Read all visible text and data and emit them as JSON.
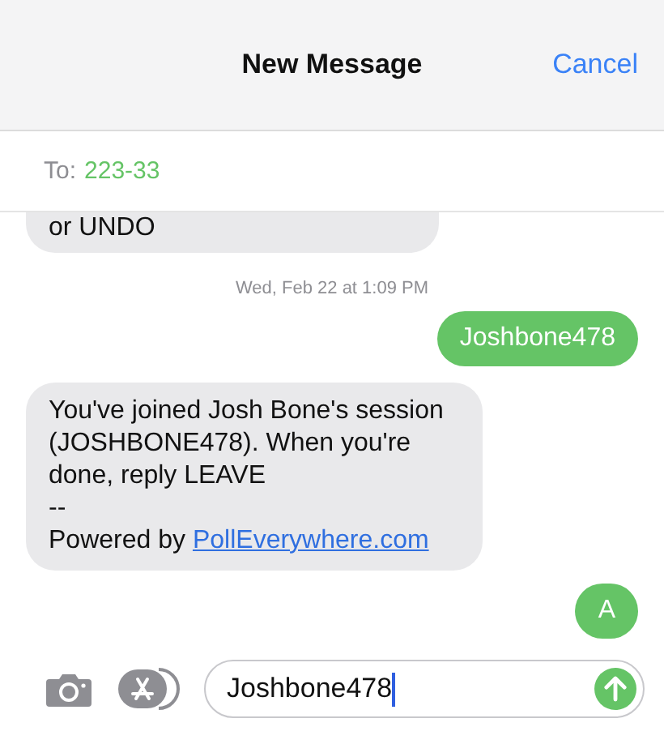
{
  "header": {
    "title": "New Message",
    "cancel": "Cancel"
  },
  "to": {
    "label": "To:",
    "recipient": "223-33"
  },
  "messages": [
    {
      "kind": "received",
      "cut": true,
      "text": "or UNDO"
    },
    {
      "kind": "timestamp",
      "text": "Wed, Feb 22 at 1:09 PM"
    },
    {
      "kind": "sent",
      "text": "Joshbone478"
    },
    {
      "kind": "received",
      "cut": false,
      "text": "You've joined Josh Bone's session (JOSHBONE478). When you're done, reply LEAVE\n--\nPowered by",
      "link": "PollEverywhere.com"
    },
    {
      "kind": "sent",
      "text": "A"
    }
  ],
  "composer": {
    "value": "Joshbone478"
  }
}
